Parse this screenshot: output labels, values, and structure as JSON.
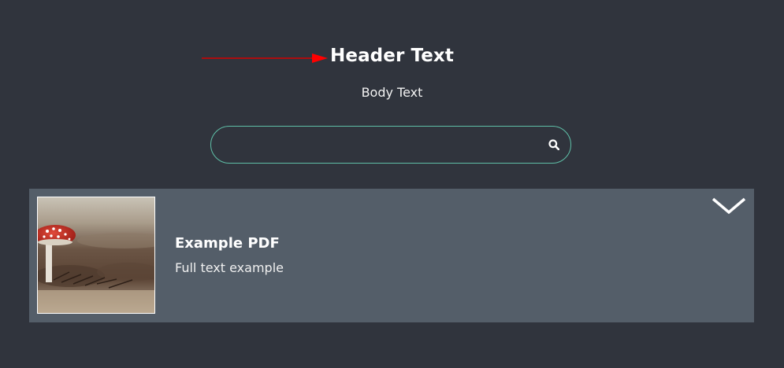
{
  "header": {
    "title": "Header Text",
    "body": "Body Text"
  },
  "search": {
    "value": "",
    "placeholder": "",
    "icon": "search-icon"
  },
  "result": {
    "title": "Example PDF",
    "description": "Full text example",
    "thumbnail": "mushroom-photo",
    "toggle_icon": "chevron-down-icon"
  },
  "colors": {
    "background": "#30343d",
    "card": "#545e69",
    "search_border": "#5fc0a8",
    "arrow": "#e00000",
    "text": "#ffffff"
  }
}
